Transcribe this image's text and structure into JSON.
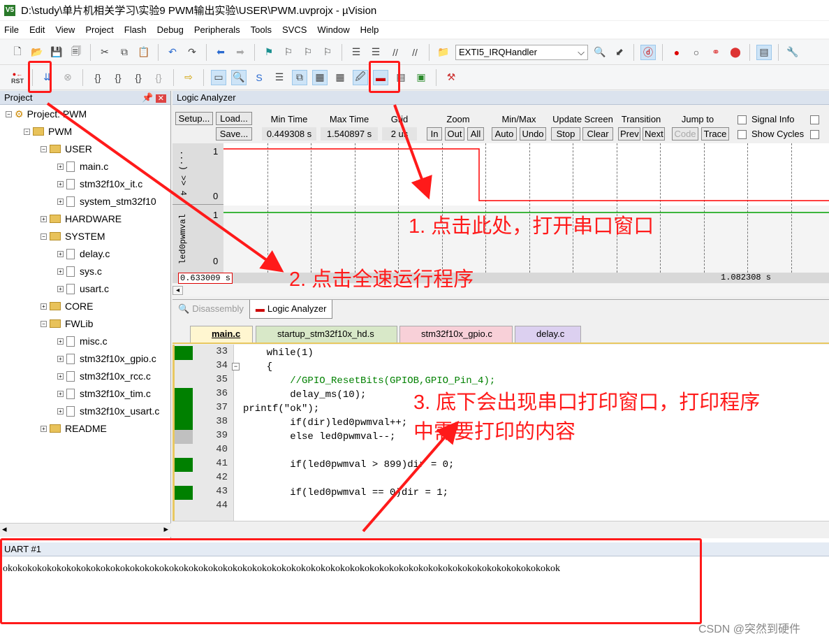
{
  "window": {
    "title": "D:\\study\\单片机相关学习\\实验9 PWM输出实验\\USER\\PWM.uvprojx - µVision",
    "icon": "V5"
  },
  "menu": [
    "File",
    "Edit",
    "View",
    "Project",
    "Flash",
    "Debug",
    "Peripherals",
    "Tools",
    "SVCS",
    "Window",
    "Help"
  ],
  "toolbar": {
    "function_combo": "EXTI5_IRQHandler",
    "rst_label": "RST"
  },
  "project": {
    "title": "Project",
    "root": "Project: PWM",
    "items": [
      {
        "label": "PWM",
        "type": "folder"
      },
      {
        "label": "USER",
        "type": "folder"
      },
      {
        "label": "main.c",
        "type": "file"
      },
      {
        "label": "stm32f10x_it.c",
        "type": "file"
      },
      {
        "label": "system_stm32f10",
        "type": "file"
      },
      {
        "label": "HARDWARE",
        "type": "folder"
      },
      {
        "label": "SYSTEM",
        "type": "folder"
      },
      {
        "label": "delay.c",
        "type": "file"
      },
      {
        "label": "sys.c",
        "type": "file"
      },
      {
        "label": "usart.c",
        "type": "file"
      },
      {
        "label": "CORE",
        "type": "folder"
      },
      {
        "label": "FWLib",
        "type": "folder"
      },
      {
        "label": "misc.c",
        "type": "file"
      },
      {
        "label": "stm32f10x_gpio.c",
        "type": "file"
      },
      {
        "label": "stm32f10x_rcc.c",
        "type": "file"
      },
      {
        "label": "stm32f10x_tim.c",
        "type": "file"
      },
      {
        "label": "stm32f10x_usart.c",
        "type": "file"
      },
      {
        "label": "README",
        "type": "folder"
      }
    ]
  },
  "logic": {
    "title": "Logic Analyzer",
    "setup": "Setup...",
    "load": "Load...",
    "save": "Save...",
    "min_time_label": "Min Time",
    "min_time": "0.449308 s",
    "max_time_label": "Max Time",
    "max_time": "1.540897 s",
    "grid_label": "Grid",
    "grid": "2 us",
    "zoom_label": "Zoom",
    "zoom_in": "In",
    "zoom_out": "Out",
    "zoom_all": "All",
    "minmax_label": "Min/Max",
    "auto": "Auto",
    "undo": "Undo",
    "update_label": "Update Screen",
    "stop": "Stop",
    "clear": "Clear",
    "transition_label": "Transition",
    "prev": "Prev",
    "next": "Next",
    "jump_label": "Jump to",
    "code": "Code",
    "trace": "Trace",
    "signal_info": "Signal Info",
    "show_cycles": "Show Cycles",
    "signals": [
      {
        "name": "...) >> 4",
        "hi": "1",
        "lo": "0",
        "color": "#ff0000"
      },
      {
        "name": "led0pwmval",
        "hi": "1",
        "lo": "0",
        "color": "#00a000"
      }
    ],
    "cursor_time": "0.633009 s",
    "right_time": "1.082308 s"
  },
  "bottom_tabs": [
    "Disassembly",
    "Logic Analyzer"
  ],
  "editor": {
    "tabs": [
      "main.c",
      "startup_stm32f10x_hd.s",
      "stm32f10x_gpio.c",
      "delay.c"
    ],
    "lines": [
      {
        "n": "33",
        "t": "    while(1)"
      },
      {
        "n": "34",
        "t": "    {"
      },
      {
        "n": "35",
        "t": "        //GPIO_ResetBits(GPIOB,GPIO_Pin_4);"
      },
      {
        "n": "36",
        "t": "        delay_ms(10);"
      },
      {
        "n": "37",
        "t": "printf(\"ok\");"
      },
      {
        "n": "38",
        "t": "        if(dir)led0pwmval++;"
      },
      {
        "n": "39",
        "t": "        else led0pwmval--;"
      },
      {
        "n": "40",
        "t": ""
      },
      {
        "n": "41",
        "t": "        if(led0pwmval > 899)dir = 0;"
      },
      {
        "n": "42",
        "t": ""
      },
      {
        "n": "43",
        "t": "        if(led0pwmval == 0)dir = 1;"
      },
      {
        "n": "44",
        "t": ""
      }
    ]
  },
  "uart": {
    "title": "UART #1",
    "output": "okokokokokokokokokokokokokokokokokokokokokokokokokokokokokokokokokokokokokokokokokokokokokokokokokokokokokokokokok"
  },
  "annotations": {
    "a1": "1. 点击此处，打开串口窗口",
    "a2": "2. 点击全速运行程序",
    "a3_1": "3. 底下会出现串口打印窗口，打印程序",
    "a3_2": "中需要打印的内容",
    "color": "#ff1a1a"
  },
  "watermark": "CSDN @突然到硬件"
}
